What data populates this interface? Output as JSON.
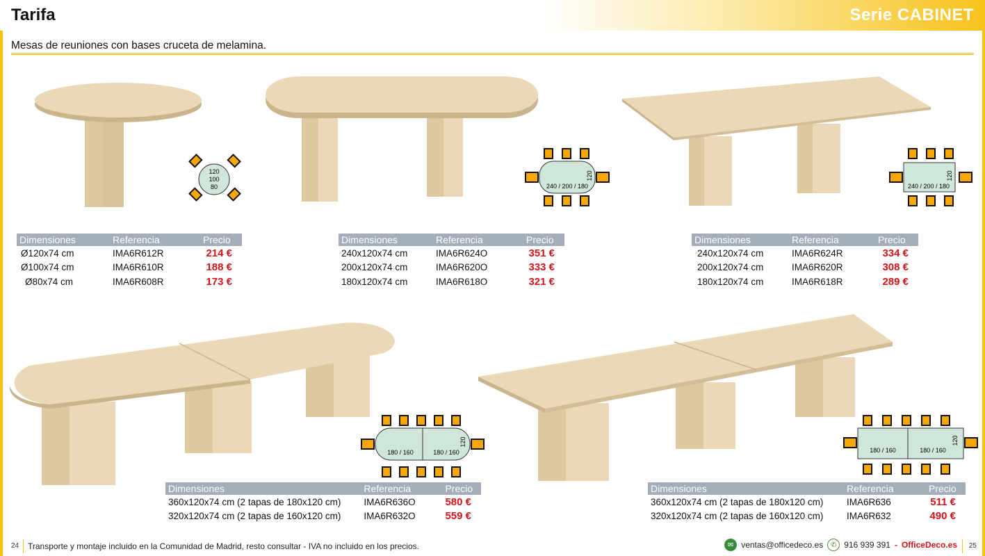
{
  "header": {
    "title": "Tarifa",
    "series": "Serie CABINET",
    "subtitle": "Mesas de reuniones con bases cruceta de melamina."
  },
  "colors": {
    "accent": "#f8c21a",
    "price": "#d4141b",
    "table_header": "#a3aeba",
    "wood": "#e6d4b2",
    "diagram_top": "#cfe6da"
  },
  "products": [
    {
      "diagram_labels": [
        "120",
        "100",
        "80"
      ],
      "columns": [
        "Dimensiones",
        "Referencia",
        "Precio"
      ],
      "rows": [
        {
          "dim": "Ø120x74 cm",
          "ref": "IMA6R612R",
          "price": "214 €"
        },
        {
          "dim": "Ø100x74 cm",
          "ref": "IMA6R610R",
          "price": "188 €"
        },
        {
          "dim": "Ø80x74 cm",
          "ref": "IMA6R608R",
          "price": "173 €"
        }
      ]
    },
    {
      "diagram_labels": [
        "240 / 200 / 180",
        "120"
      ],
      "columns": [
        "Dimensiones",
        "Referencia",
        "Precio"
      ],
      "rows": [
        {
          "dim": "240x120x74 cm",
          "ref": "IMA6R624O",
          "price": "351 €"
        },
        {
          "dim": "200x120x74 cm",
          "ref": "IMA6R620O",
          "price": "333 €"
        },
        {
          "dim": "180x120x74 cm",
          "ref": "IMA6R618O",
          "price": "321 €"
        }
      ]
    },
    {
      "diagram_labels": [
        "240 / 200 / 180",
        "120"
      ],
      "columns": [
        "Dimensiones",
        "Referencia",
        "Precio"
      ],
      "rows": [
        {
          "dim": "240x120x74 cm",
          "ref": "IMA6R624R",
          "price": "334 €"
        },
        {
          "dim": "200x120x74 cm",
          "ref": "IMA6R620R",
          "price": "308 €"
        },
        {
          "dim": "180x120x74 cm",
          "ref": "IMA6R618R",
          "price": "289 €"
        }
      ]
    },
    {
      "diagram_labels": [
        "180 / 160",
        "180 / 160",
        "120"
      ],
      "columns": [
        "Dimensiones",
        "Referencia",
        "Precio"
      ],
      "rows": [
        {
          "dim": "360x120x74 cm (2 tapas de 180x120 cm)",
          "ref": "IMA6R636O",
          "price": "580 €"
        },
        {
          "dim": "320x120x74 cm (2 tapas de 160x120 cm)",
          "ref": "IMA6R632O",
          "price": "559 €"
        }
      ]
    },
    {
      "diagram_labels": [
        "180 / 160",
        "180 / 160",
        "120"
      ],
      "columns": [
        "Dimensiones",
        "Referencia",
        "Precio"
      ],
      "rows": [
        {
          "dim": "360x120x74 cm (2 tapas de 180x120 cm)",
          "ref": "IMA6R636",
          "price": "511 €"
        },
        {
          "dim": "320x120x74 cm (2 tapas de 160x120 cm)",
          "ref": "IMA6R632",
          "price": "490 €"
        }
      ]
    }
  ],
  "footer": {
    "page_left": "24",
    "page_right": "25",
    "note": "Transporte y montaje incluido en la Comunidad de Madrid, resto consultar - IVA no incluido en los precios.",
    "email": "ventas@officedeco.es",
    "phone": "916 939 391",
    "dash": "-",
    "brand": "OfficeDeco.es",
    "email_icon": "mail-icon",
    "phone_icon": "phone-icon"
  }
}
